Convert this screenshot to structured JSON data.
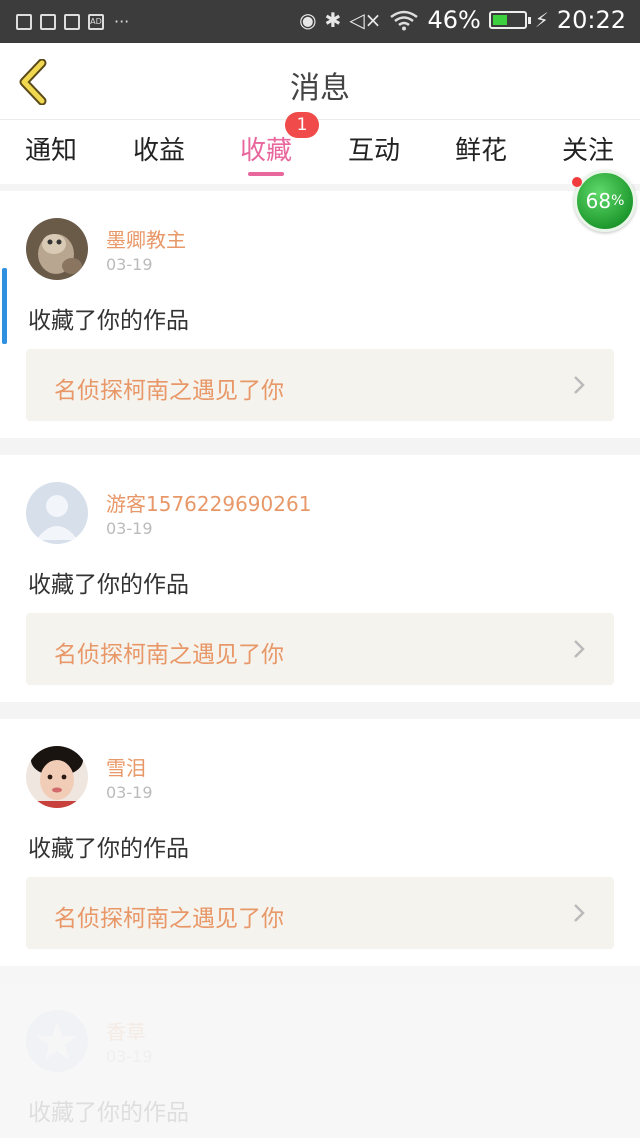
{
  "status_bar": {
    "battery_percent": "46%",
    "battery_level": 0.46,
    "time": "20:22",
    "left_icons": [
      "gallery-icon",
      "calendar-icon",
      "calendar-icon",
      "ad-icon",
      "more-dots-icon"
    ],
    "right_icons": [
      "vibrate-icon",
      "bluetooth-icon",
      "mute-icon",
      "wifi-icon",
      "battery-icon",
      "charging-icon"
    ]
  },
  "header": {
    "title": "消息",
    "back_icon": "chevron-left-icon"
  },
  "tabs": {
    "items": [
      {
        "label": "通知"
      },
      {
        "label": "收益"
      },
      {
        "label": "收藏"
      },
      {
        "label": "互动"
      },
      {
        "label": "鲜花"
      },
      {
        "label": "关注"
      }
    ],
    "active_index": 2,
    "badge": "1",
    "active_color": "#e8679c"
  },
  "float_ball": {
    "value": "68",
    "unit": "%"
  },
  "messages": [
    {
      "name": "墨卿教主",
      "date": "03-19",
      "action": "收藏了你的作品",
      "work_title": "名侦探柯南之遇见了你",
      "avatar": "cat-photo-avatar"
    },
    {
      "name": "游客1576229690261",
      "date": "03-19",
      "action": "收藏了你的作品",
      "work_title": "名侦探柯南之遇见了你",
      "avatar": "default-person-avatar"
    },
    {
      "name": "雪泪",
      "date": "03-19",
      "action": "收藏了你的作品",
      "work_title": "名侦探柯南之遇见了你",
      "avatar": "girl-photo-avatar"
    },
    {
      "name": "香草",
      "date": "03-19",
      "action": "收藏了你的作品",
      "work_title": "",
      "avatar": "star-default-avatar"
    }
  ],
  "colors": {
    "name_orange": "#e89868",
    "tab_pink": "#e8679c",
    "badge_red": "#f04a4a",
    "link_bg": "#f5f3ee"
  }
}
